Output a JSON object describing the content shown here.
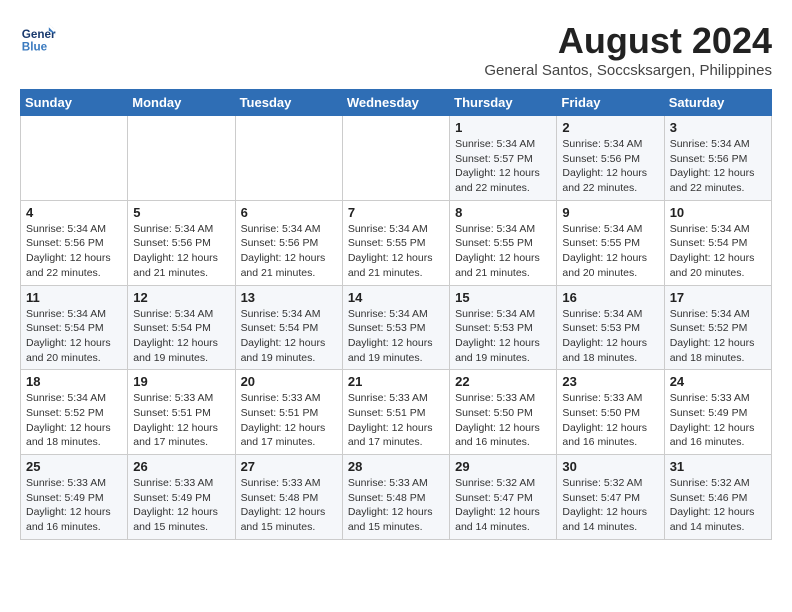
{
  "logo": {
    "line1": "General",
    "line2": "Blue"
  },
  "title": "August 2024",
  "subtitle": "General Santos, Soccsksargen, Philippines",
  "weekdays": [
    "Sunday",
    "Monday",
    "Tuesday",
    "Wednesday",
    "Thursday",
    "Friday",
    "Saturday"
  ],
  "weeks": [
    [
      {
        "num": "",
        "info": ""
      },
      {
        "num": "",
        "info": ""
      },
      {
        "num": "",
        "info": ""
      },
      {
        "num": "",
        "info": ""
      },
      {
        "num": "1",
        "info": "Sunrise: 5:34 AM\nSunset: 5:57 PM\nDaylight: 12 hours\nand 22 minutes."
      },
      {
        "num": "2",
        "info": "Sunrise: 5:34 AM\nSunset: 5:56 PM\nDaylight: 12 hours\nand 22 minutes."
      },
      {
        "num": "3",
        "info": "Sunrise: 5:34 AM\nSunset: 5:56 PM\nDaylight: 12 hours\nand 22 minutes."
      }
    ],
    [
      {
        "num": "4",
        "info": "Sunrise: 5:34 AM\nSunset: 5:56 PM\nDaylight: 12 hours\nand 22 minutes."
      },
      {
        "num": "5",
        "info": "Sunrise: 5:34 AM\nSunset: 5:56 PM\nDaylight: 12 hours\nand 21 minutes."
      },
      {
        "num": "6",
        "info": "Sunrise: 5:34 AM\nSunset: 5:56 PM\nDaylight: 12 hours\nand 21 minutes."
      },
      {
        "num": "7",
        "info": "Sunrise: 5:34 AM\nSunset: 5:55 PM\nDaylight: 12 hours\nand 21 minutes."
      },
      {
        "num": "8",
        "info": "Sunrise: 5:34 AM\nSunset: 5:55 PM\nDaylight: 12 hours\nand 21 minutes."
      },
      {
        "num": "9",
        "info": "Sunrise: 5:34 AM\nSunset: 5:55 PM\nDaylight: 12 hours\nand 20 minutes."
      },
      {
        "num": "10",
        "info": "Sunrise: 5:34 AM\nSunset: 5:54 PM\nDaylight: 12 hours\nand 20 minutes."
      }
    ],
    [
      {
        "num": "11",
        "info": "Sunrise: 5:34 AM\nSunset: 5:54 PM\nDaylight: 12 hours\nand 20 minutes."
      },
      {
        "num": "12",
        "info": "Sunrise: 5:34 AM\nSunset: 5:54 PM\nDaylight: 12 hours\nand 19 minutes."
      },
      {
        "num": "13",
        "info": "Sunrise: 5:34 AM\nSunset: 5:54 PM\nDaylight: 12 hours\nand 19 minutes."
      },
      {
        "num": "14",
        "info": "Sunrise: 5:34 AM\nSunset: 5:53 PM\nDaylight: 12 hours\nand 19 minutes."
      },
      {
        "num": "15",
        "info": "Sunrise: 5:34 AM\nSunset: 5:53 PM\nDaylight: 12 hours\nand 19 minutes."
      },
      {
        "num": "16",
        "info": "Sunrise: 5:34 AM\nSunset: 5:53 PM\nDaylight: 12 hours\nand 18 minutes."
      },
      {
        "num": "17",
        "info": "Sunrise: 5:34 AM\nSunset: 5:52 PM\nDaylight: 12 hours\nand 18 minutes."
      }
    ],
    [
      {
        "num": "18",
        "info": "Sunrise: 5:34 AM\nSunset: 5:52 PM\nDaylight: 12 hours\nand 18 minutes."
      },
      {
        "num": "19",
        "info": "Sunrise: 5:33 AM\nSunset: 5:51 PM\nDaylight: 12 hours\nand 17 minutes."
      },
      {
        "num": "20",
        "info": "Sunrise: 5:33 AM\nSunset: 5:51 PM\nDaylight: 12 hours\nand 17 minutes."
      },
      {
        "num": "21",
        "info": "Sunrise: 5:33 AM\nSunset: 5:51 PM\nDaylight: 12 hours\nand 17 minutes."
      },
      {
        "num": "22",
        "info": "Sunrise: 5:33 AM\nSunset: 5:50 PM\nDaylight: 12 hours\nand 16 minutes."
      },
      {
        "num": "23",
        "info": "Sunrise: 5:33 AM\nSunset: 5:50 PM\nDaylight: 12 hours\nand 16 minutes."
      },
      {
        "num": "24",
        "info": "Sunrise: 5:33 AM\nSunset: 5:49 PM\nDaylight: 12 hours\nand 16 minutes."
      }
    ],
    [
      {
        "num": "25",
        "info": "Sunrise: 5:33 AM\nSunset: 5:49 PM\nDaylight: 12 hours\nand 16 minutes."
      },
      {
        "num": "26",
        "info": "Sunrise: 5:33 AM\nSunset: 5:49 PM\nDaylight: 12 hours\nand 15 minutes."
      },
      {
        "num": "27",
        "info": "Sunrise: 5:33 AM\nSunset: 5:48 PM\nDaylight: 12 hours\nand 15 minutes."
      },
      {
        "num": "28",
        "info": "Sunrise: 5:33 AM\nSunset: 5:48 PM\nDaylight: 12 hours\nand 15 minutes."
      },
      {
        "num": "29",
        "info": "Sunrise: 5:32 AM\nSunset: 5:47 PM\nDaylight: 12 hours\nand 14 minutes."
      },
      {
        "num": "30",
        "info": "Sunrise: 5:32 AM\nSunset: 5:47 PM\nDaylight: 12 hours\nand 14 minutes."
      },
      {
        "num": "31",
        "info": "Sunrise: 5:32 AM\nSunset: 5:46 PM\nDaylight: 12 hours\nand 14 minutes."
      }
    ]
  ]
}
